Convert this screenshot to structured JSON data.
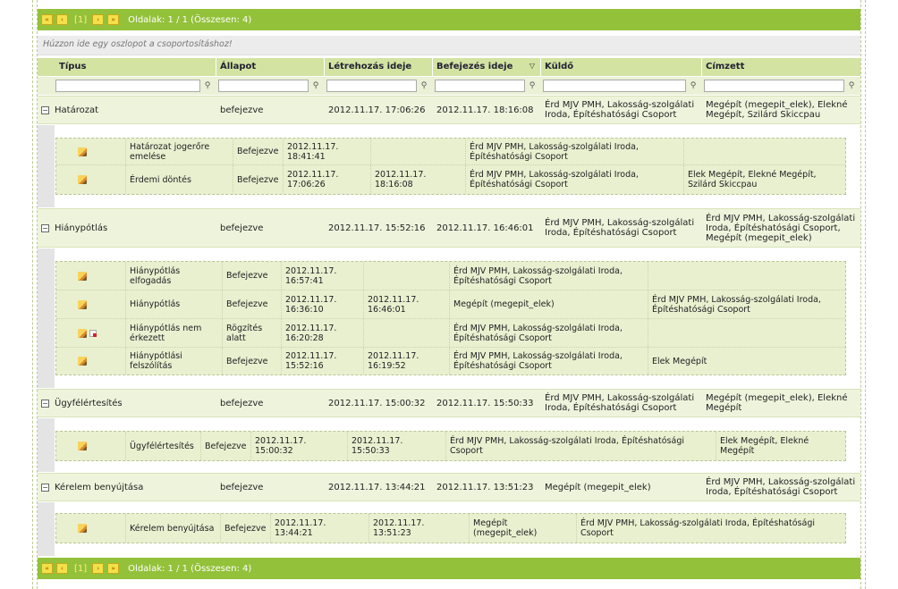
{
  "pager": {
    "first": "«",
    "prev": "‹",
    "current": "[1]",
    "next": "›",
    "last": "»",
    "info": "Oldalak: 1 / 1 (Összesen: 4)"
  },
  "group_hint": "Húzzon ide egy oszlopot a csoportosításhoz!",
  "columns": [
    "Típus",
    "Állapot",
    "Létrehozás ideje",
    "Befejezés ideje",
    "Küldő",
    "Címzett"
  ],
  "groups": [
    {
      "type": "Határozat",
      "status": "befejezve",
      "created": "2012.11.17. 17:06:26",
      "finished": "2012.11.17. 18:16:08",
      "sender": "Érd MJV PMH, Lakosság-szolgálati Iroda, Építéshatósági Csoport",
      "recipient": "Megépít (megepit_elek), Elekné Megépít, Szilárd Skiccpau",
      "expander": "−",
      "items": [
        {
          "type": "Határozat jogerőre emelése",
          "status": "Befejezve",
          "created": "2012.11.17. 18:41:41",
          "finished": "",
          "sender": "Érd MJV PMH, Lakosság-szolgálati Iroda, Építéshatósági Csoport",
          "recipient": ""
        },
        {
          "type": "Érdemi döntés",
          "status": "Befejezve",
          "created": "2012.11.17. 17:06:26",
          "finished": "2012.11.17. 18:16:08",
          "sender": "Érd MJV PMH, Lakosság-szolgálati Iroda, Építéshatósági Csoport",
          "recipient": "Elek Megépít, Elekné Megépít, Szilárd Skiccpau"
        }
      ]
    },
    {
      "type": "Hiánypótlás",
      "status": "befejezve",
      "created": "2012.11.17. 15:52:16",
      "finished": "2012.11.17. 16:46:01",
      "sender": "Érd MJV PMH, Lakosság-szolgálati Iroda, Építéshatósági Csoport",
      "recipient": "Érd MJV PMH, Lakosság-szolgálati Iroda, Építéshatósági Csoport, Megépít (megepit_elek)",
      "expander": "−",
      "items": [
        {
          "type": "Hiánypótlás elfogadás",
          "status": "Befejezve",
          "created": "2012.11.17. 16:57:41",
          "finished": "",
          "sender": "Érd MJV PMH, Lakosság-szolgálati Iroda, Építéshatósági Csoport",
          "recipient": ""
        },
        {
          "type": "Hiánypótlás",
          "status": "Befejezve",
          "created": "2012.11.17. 16:36:10",
          "finished": "2012.11.17. 16:46:01",
          "sender": "Megépít (megepit_elek)",
          "recipient": "Érd MJV PMH, Lakosság-szolgálati Iroda, Építéshatósági Csoport"
        },
        {
          "type": "Hiánypótlás nem érkezett",
          "status": "Rögzítés alatt",
          "created": "2012.11.17. 16:20:28",
          "finished": "",
          "sender": "Érd MJV PMH, Lakosság-szolgálati Iroda, Építéshatósági Csoport",
          "recipient": ""
        },
        {
          "type": "Hiánypótlási felszólítás",
          "status": "Befejezve",
          "created": "2012.11.17. 15:52:16",
          "finished": "2012.11.17. 16:19:52",
          "sender": "Érd MJV PMH, Lakosság-szolgálati Iroda, Építéshatósági Csoport",
          "recipient": "Elek Megépít"
        }
      ]
    },
    {
      "type": "Ügyfélértesítés",
      "status": "befejezve",
      "created": "2012.11.17. 15:00:32",
      "finished": "2012.11.17. 15:50:33",
      "sender": "Érd MJV PMH, Lakosság-szolgálati Iroda, Építéshatósági Csoport",
      "recipient": "Megépít (megepit_elek), Elekné Megépít",
      "expander": "−",
      "items": [
        {
          "type": "Ügyfélértesítés",
          "status": "Befejezve",
          "created": "2012.11.17. 15:00:32",
          "finished": "2012.11.17. 15:50:33",
          "sender": "Érd MJV PMH, Lakosság-szolgálati Iroda, Építéshatósági Csoport",
          "recipient": "Elek Megépít, Elekné Megépít"
        }
      ]
    },
    {
      "type": "Kérelem benyújtása",
      "status": "befejezve",
      "created": "2012.11.17. 13:44:21",
      "finished": "2012.11.17. 13:51:23",
      "sender": "Megépít (megepit_elek)",
      "recipient": "Érd MJV PMH, Lakosság-szolgálati Iroda, Építéshatósági Csoport",
      "expander": "−",
      "items": [
        {
          "type": "Kérelem benyújtása",
          "status": "Befejezve",
          "created": "2012.11.17. 13:44:21",
          "finished": "2012.11.17. 13:51:23",
          "sender": "Megépít (megepit_elek)",
          "recipient": "Érd MJV PMH, Lakosság-szolgálati Iroda, Építéshatósági Csoport"
        }
      ]
    }
  ]
}
